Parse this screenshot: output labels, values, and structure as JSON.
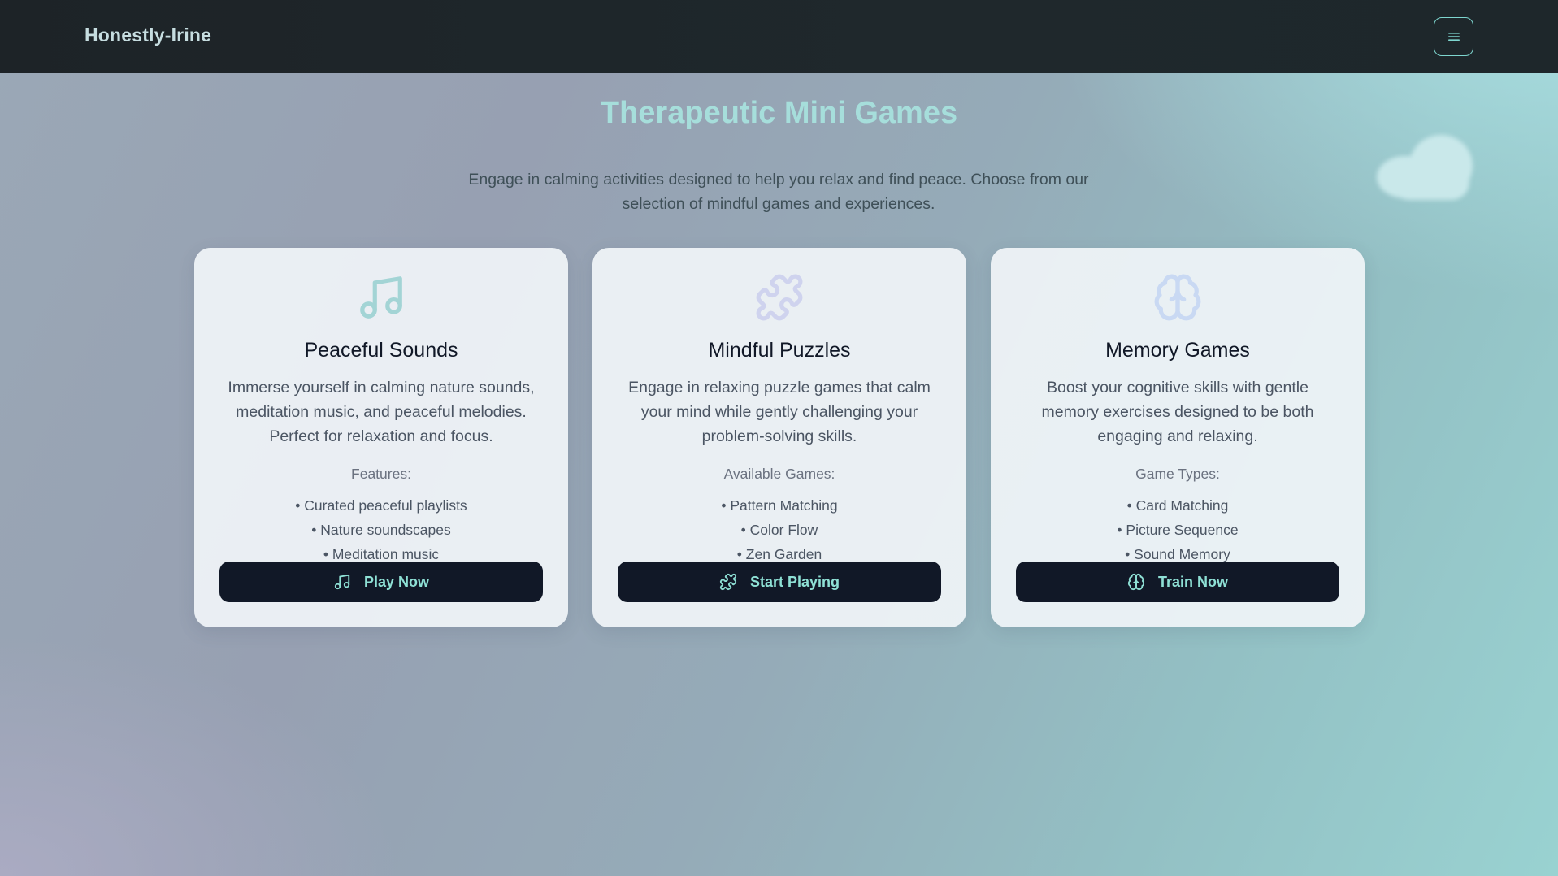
{
  "nav": {
    "brand": "Honestly-Irine",
    "menu_icon": "hamburger-menu-icon"
  },
  "header": {
    "title": "Therapeutic Mini Games",
    "intro": "Engage in calming activities designed to help you relax and find peace. Choose from our selection of mindful games and experiences."
  },
  "colors": {
    "title_teal": "#a6dedb",
    "button_bg": "#111827",
    "button_text": "#8ee0d5",
    "nav_bg": "#1d2327",
    "music_icon": "#a3d4d5",
    "puzzle_icon": "#cfd3ee",
    "brain_icon": "#c9d9f3"
  },
  "cards": [
    {
      "icon": "music-note-icon",
      "title": "Peaceful Sounds",
      "description": "Immerse yourself in calming nature sounds, meditation music, and peaceful melodies. Perfect for relaxation and focus.",
      "features_heading": "Features:",
      "features": [
        "Curated peaceful playlists",
        "Nature soundscapes",
        "Meditation music"
      ],
      "button_label": "Play Now"
    },
    {
      "icon": "puzzle-piece-icon",
      "title": "Mindful Puzzles",
      "description": "Engage in relaxing puzzle games that calm your mind while gently challenging your problem-solving skills.",
      "features_heading": "Available Games:",
      "features": [
        "Pattern Matching",
        "Color Flow",
        "Zen Garden"
      ],
      "button_label": "Start Playing"
    },
    {
      "icon": "brain-icon",
      "title": "Memory Games",
      "description": "Boost your cognitive skills with gentle memory exercises designed to be both engaging and relaxing.",
      "features_heading": "Game Types:",
      "features": [
        "Card Matching",
        "Picture Sequence",
        "Sound Memory"
      ],
      "button_label": "Train Now"
    }
  ]
}
